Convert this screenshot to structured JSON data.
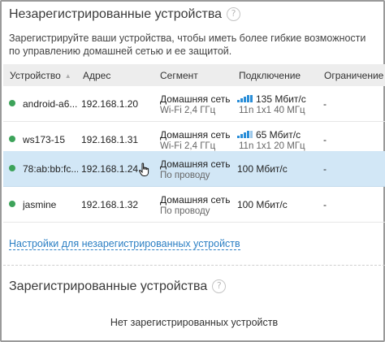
{
  "unregistered": {
    "title": "Незарегистрированные устройства",
    "help_icon": "?",
    "description": "Зарегистрируйте ваши устройства, чтобы иметь более гибкие возможности по управлению  домашней сетью и ее защитой.",
    "columns": {
      "device": "Устройство",
      "address": "Адрес",
      "segment": "Сегмент",
      "connection": "Подключение",
      "limit": "Ограничение"
    },
    "sort_indicator": "▲",
    "rows": [
      {
        "name": "android-a6...",
        "address": "192.168.1.20",
        "segment": "Домашняя сеть",
        "segment_sub": "Wi-Fi 2,4 ГГц",
        "speed": "135 Мбит/с",
        "speed_sub": "11n 1x1 40 МГц",
        "limit": "-",
        "status_color": "#3da35a",
        "wifi_icon": "wifi-signal-icon"
      },
      {
        "name": "ws173-15",
        "address": "192.168.1.31",
        "segment": "Домашняя сеть",
        "segment_sub": "Wi-Fi 2,4 ГГц",
        "speed": "65 Мбит/с",
        "speed_sub": "11n 1x1 20 МГц",
        "limit": "-",
        "status_color": "#3da35a",
        "wifi_icon": "wifi-signal-icon"
      },
      {
        "name": "78:ab:bb:fc...",
        "address": "192.168.1.24",
        "segment": "Домашняя сеть",
        "segment_sub": "По проводу",
        "speed": "100 Мбит/с",
        "limit": "-",
        "status_color": "#3da35a",
        "hovered": true
      },
      {
        "name": "jasmine",
        "address": "192.168.1.32",
        "segment": "Домашняя сеть",
        "segment_sub": "По проводу",
        "speed": "100 Мбит/с",
        "limit": "-",
        "status_color": "#3da35a"
      }
    ],
    "settings_link": "Настройки для незарегистрированных устройств"
  },
  "registered": {
    "title": "Зарегистрированные устройства",
    "help_icon": "?",
    "empty_text": "Нет зарегистрированных устройств"
  },
  "colors": {
    "accent": "#2b7fc4",
    "online": "#3da35a",
    "hover_row": "#d2e7f6",
    "header_bg": "#ededed",
    "wifi": "#2a8ed8"
  }
}
